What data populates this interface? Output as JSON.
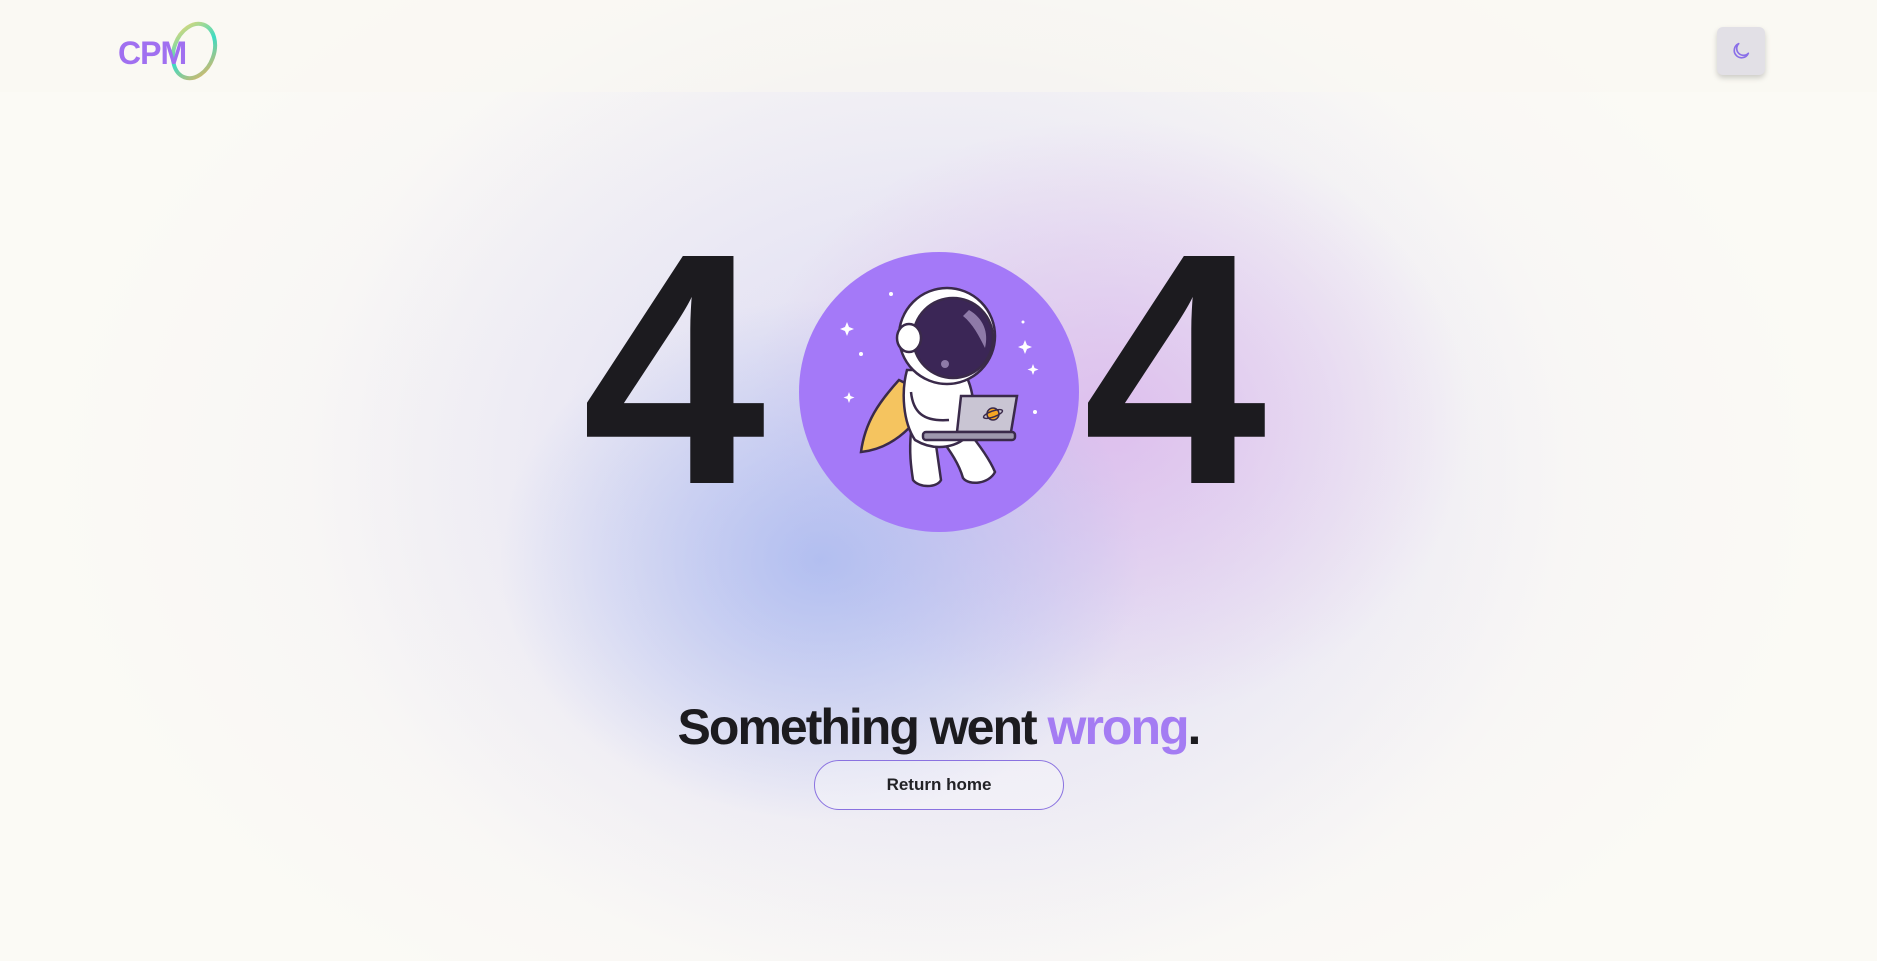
{
  "header": {
    "logo_text": "CPM",
    "theme_toggle_icon": "moon-icon"
  },
  "hero": {
    "digit_left": "4",
    "digit_right": "4",
    "illustration": "astronaut-with-laptop"
  },
  "message": {
    "prefix": "Something went ",
    "accent": "wrong",
    "suffix": "."
  },
  "actions": {
    "return_home_label": "Return home"
  },
  "colors": {
    "accent": "#a47cf3",
    "circle": "#a479f8",
    "text": "#1c1b1f",
    "button_border": "#8a72e0"
  }
}
